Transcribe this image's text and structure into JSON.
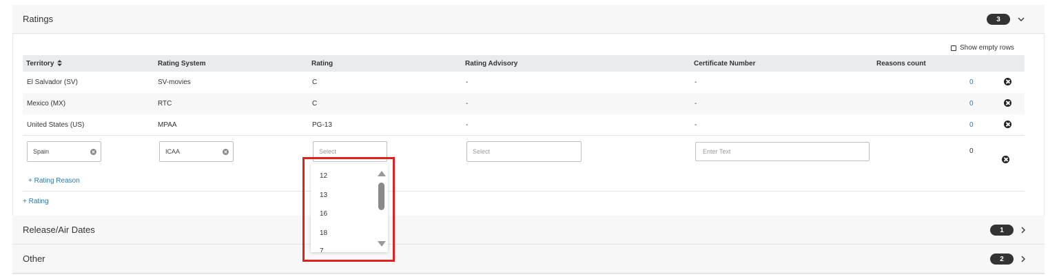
{
  "ratings_section": {
    "title": "Ratings",
    "count": "3",
    "show_empty_rows_label": "Show empty rows",
    "columns": [
      "Territory",
      "Rating System",
      "Rating",
      "Rating Advisory",
      "Certificate Number",
      "Reasons count"
    ],
    "rows": [
      {
        "territory": "El Salvador (SV)",
        "system": "SV-movies",
        "rating": "C",
        "advisory": "-",
        "certificate": "-",
        "reasons": "0"
      },
      {
        "territory": "Mexico (MX)",
        "system": "RTC",
        "rating": "C",
        "advisory": "-",
        "certificate": "-",
        "reasons": "0"
      },
      {
        "territory": "United States (US)",
        "system": "MPAA",
        "rating": "PG-13",
        "advisory": "-",
        "certificate": "-",
        "reasons": "0"
      }
    ],
    "new_row": {
      "territory_value": "Spain",
      "system_value": "ICAA",
      "rating_placeholder": "Select",
      "advisory_placeholder": "Select",
      "certificate_placeholder": "Enter Text",
      "reasons": "0"
    },
    "add_reason_label": "+ Rating Reason",
    "add_rating_label": "+ Rating"
  },
  "rating_dropdown": {
    "options": [
      "12",
      "13",
      "16",
      "18",
      "7"
    ]
  },
  "release_section": {
    "title": "Release/Air Dates",
    "count": "1"
  },
  "other_section": {
    "title": "Other",
    "count": "2"
  },
  "colors": {
    "link": "#1a7ac0",
    "badge": "#333333",
    "highlight": "#e0201e"
  }
}
